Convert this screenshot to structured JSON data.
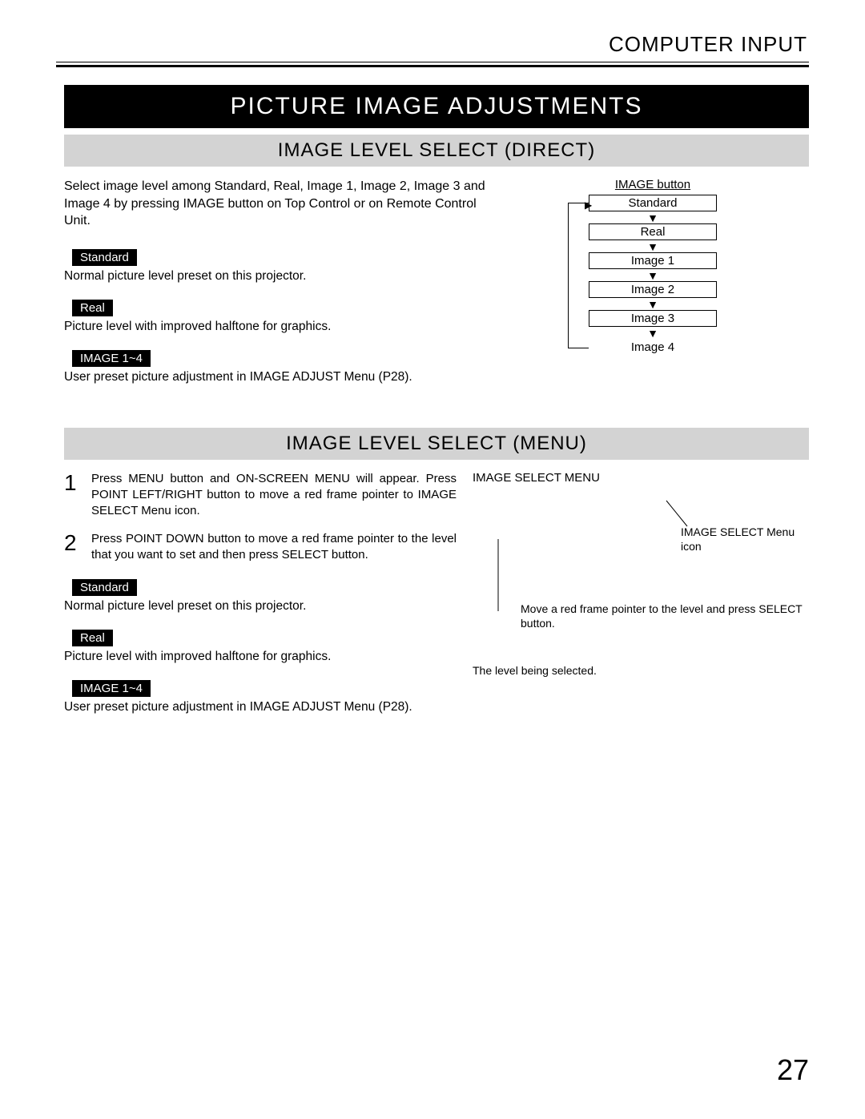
{
  "header": {
    "category": "COMPUTER INPUT"
  },
  "main_title": "PICTURE IMAGE ADJUSTMENTS",
  "section_direct": {
    "title": "IMAGE LEVEL SELECT (DIRECT)",
    "intro": "Select image level among Standard, Real, Image 1, Image 2, Image 3 and Image 4 by pressing IMAGE button on Top Control or on Remote Control Unit.",
    "items": [
      {
        "label": "Standard",
        "desc": "Normal picture level preset on this projector."
      },
      {
        "label": "Real",
        "desc": "Picture level with improved halftone for graphics."
      },
      {
        "label": "IMAGE 1~4",
        "desc": "User preset picture adjustment in IMAGE ADJUST Menu (P28)."
      }
    ],
    "diagram": {
      "button_label": "IMAGE button",
      "levels": [
        "Standard",
        "Real",
        "Image 1",
        "Image 2",
        "Image 3",
        "Image 4"
      ]
    }
  },
  "section_menu": {
    "title": "IMAGE LEVEL SELECT (MENU)",
    "steps": [
      {
        "num": "1",
        "text": "Press MENU button and ON-SCREEN MENU will appear.  Press POINT LEFT/RIGHT button to move a red frame pointer to IMAGE SELECT Menu icon."
      },
      {
        "num": "2",
        "text": "Press POINT DOWN button to move a red frame pointer to the level that you want to set and then press SELECT button."
      }
    ],
    "items": [
      {
        "label": "Standard",
        "desc": "Normal picture level preset on this projector."
      },
      {
        "label": "Real",
        "desc": "Picture level with improved halftone for graphics."
      },
      {
        "label": "IMAGE 1~4",
        "desc": "User preset picture adjustment in IMAGE ADJUST Menu (P28)."
      }
    ],
    "right": {
      "menu_label": "IMAGE SELECT MENU",
      "icon_callout": "IMAGE SELECT Menu icon",
      "pointer_callout": "Move a red frame pointer to the level and press SELECT button.",
      "selected_callout": "The level being selected."
    }
  },
  "page_number": "27"
}
